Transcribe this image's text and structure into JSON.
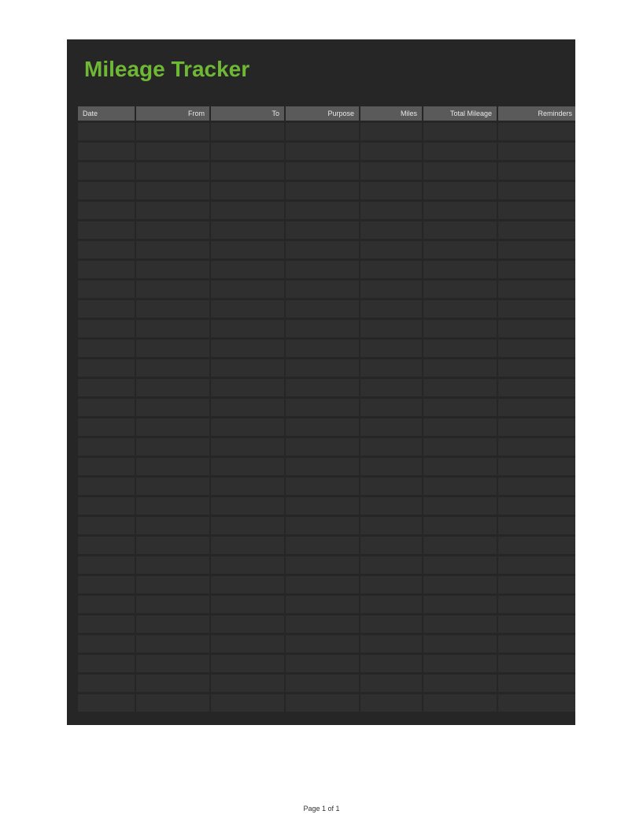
{
  "title": "Mileage Tracker",
  "columns": [
    {
      "label": "Date",
      "align": "left"
    },
    {
      "label": "From",
      "align": "right"
    },
    {
      "label": "To",
      "align": "right"
    },
    {
      "label": "Purpose",
      "align": "right"
    },
    {
      "label": "Miles",
      "align": "right"
    },
    {
      "label": "Total Mileage",
      "align": "right"
    },
    {
      "label": "Reminders",
      "align": "right"
    }
  ],
  "rows": [
    [
      "",
      "",
      "",
      "",
      "",
      "",
      ""
    ],
    [
      "",
      "",
      "",
      "",
      "",
      "",
      ""
    ],
    [
      "",
      "",
      "",
      "",
      "",
      "",
      ""
    ],
    [
      "",
      "",
      "",
      "",
      "",
      "",
      ""
    ],
    [
      "",
      "",
      "",
      "",
      "",
      "",
      ""
    ],
    [
      "",
      "",
      "",
      "",
      "",
      "",
      ""
    ],
    [
      "",
      "",
      "",
      "",
      "",
      "",
      ""
    ],
    [
      "",
      "",
      "",
      "",
      "",
      "",
      ""
    ],
    [
      "",
      "",
      "",
      "",
      "",
      "",
      ""
    ],
    [
      "",
      "",
      "",
      "",
      "",
      "",
      ""
    ],
    [
      "",
      "",
      "",
      "",
      "",
      "",
      ""
    ],
    [
      "",
      "",
      "",
      "",
      "",
      "",
      ""
    ],
    [
      "",
      "",
      "",
      "",
      "",
      "",
      ""
    ],
    [
      "",
      "",
      "",
      "",
      "",
      "",
      ""
    ],
    [
      "",
      "",
      "",
      "",
      "",
      "",
      ""
    ],
    [
      "",
      "",
      "",
      "",
      "",
      "",
      ""
    ],
    [
      "",
      "",
      "",
      "",
      "",
      "",
      ""
    ],
    [
      "",
      "",
      "",
      "",
      "",
      "",
      ""
    ],
    [
      "",
      "",
      "",
      "",
      "",
      "",
      ""
    ],
    [
      "",
      "",
      "",
      "",
      "",
      "",
      ""
    ],
    [
      "",
      "",
      "",
      "",
      "",
      "",
      ""
    ],
    [
      "",
      "",
      "",
      "",
      "",
      "",
      ""
    ],
    [
      "",
      "",
      "",
      "",
      "",
      "",
      ""
    ],
    [
      "",
      "",
      "",
      "",
      "",
      "",
      ""
    ],
    [
      "",
      "",
      "",
      "",
      "",
      "",
      ""
    ],
    [
      "",
      "",
      "",
      "",
      "",
      "",
      ""
    ],
    [
      "",
      "",
      "",
      "",
      "",
      "",
      ""
    ],
    [
      "",
      "",
      "",
      "",
      "",
      "",
      ""
    ],
    [
      "",
      "",
      "",
      "",
      "",
      "",
      ""
    ],
    [
      "",
      "",
      "",
      "",
      "",
      "",
      ""
    ]
  ],
  "footer": "Page 1 of 1"
}
